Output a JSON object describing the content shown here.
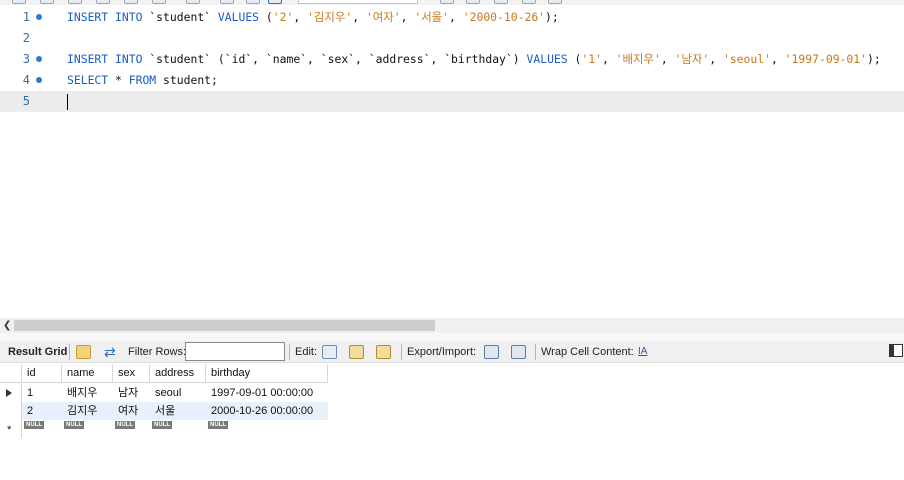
{
  "editor": {
    "lines": [
      {
        "number": "1",
        "has_marker": true,
        "tokens": [
          {
            "t": "INSERT",
            "c": "kw"
          },
          {
            "t": " "
          },
          {
            "t": "INTO",
            "c": "kw"
          },
          {
            "t": " `student` "
          },
          {
            "t": "VALUES",
            "c": "kw"
          },
          {
            "t": " ("
          },
          {
            "t": "'2'",
            "c": "str"
          },
          {
            "t": ", "
          },
          {
            "t": "'김지우'",
            "c": "str"
          },
          {
            "t": ", "
          },
          {
            "t": "'여자'",
            "c": "str"
          },
          {
            "t": ", "
          },
          {
            "t": "'서울'",
            "c": "str"
          },
          {
            "t": ", "
          },
          {
            "t": "'2000-10-26'",
            "c": "str"
          },
          {
            "t": ");"
          }
        ]
      },
      {
        "number": "2",
        "has_marker": false,
        "tokens": []
      },
      {
        "number": "3",
        "has_marker": true,
        "tokens": [
          {
            "t": "INSERT",
            "c": "kw"
          },
          {
            "t": " "
          },
          {
            "t": "INTO",
            "c": "kw"
          },
          {
            "t": " `student` (`id`, `name`, `sex`, `address`, `birthday`) "
          },
          {
            "t": "VALUES",
            "c": "kw"
          },
          {
            "t": " ("
          },
          {
            "t": "'1'",
            "c": "str"
          },
          {
            "t": ", "
          },
          {
            "t": "'배지우'",
            "c": "str"
          },
          {
            "t": ", "
          },
          {
            "t": "'남자'",
            "c": "str"
          },
          {
            "t": ", "
          },
          {
            "t": "'seoul'",
            "c": "str"
          },
          {
            "t": ", "
          },
          {
            "t": "'1997-09-01'",
            "c": "str"
          },
          {
            "t": ");"
          }
        ]
      },
      {
        "number": "4",
        "has_marker": true,
        "tokens": [
          {
            "t": "SELECT",
            "c": "kw"
          },
          {
            "t": " * "
          },
          {
            "t": "FROM",
            "c": "kw"
          },
          {
            "t": " student;"
          }
        ]
      },
      {
        "number": "5",
        "has_marker": false,
        "tokens": [],
        "current": true
      }
    ]
  },
  "result_toolbar": {
    "tab_label": "Result Grid",
    "filter_label": "Filter Rows:",
    "filter_value": "",
    "edit_label": "Edit:",
    "export_label": "Export/Import:",
    "wrap_label": "Wrap Cell Content:",
    "wrap_icon_text": "IA"
  },
  "grid": {
    "columns": [
      "id",
      "name",
      "sex",
      "address",
      "birthday"
    ],
    "rows": [
      [
        "1",
        "배지우",
        "남자",
        "seoul",
        "1997-09-01 00:00:00"
      ],
      [
        "2",
        "김지우",
        "여자",
        "서울",
        "2000-10-26 00:00:00"
      ]
    ],
    "new_row_marker": "*",
    "null_label": "NULL"
  },
  "colors": {
    "keyword": "#1a5cc0",
    "string": "#c8781a",
    "line_number": "#2f6fa7",
    "marker": "#2a7bd5",
    "row_alt": "#e8f0fb"
  }
}
